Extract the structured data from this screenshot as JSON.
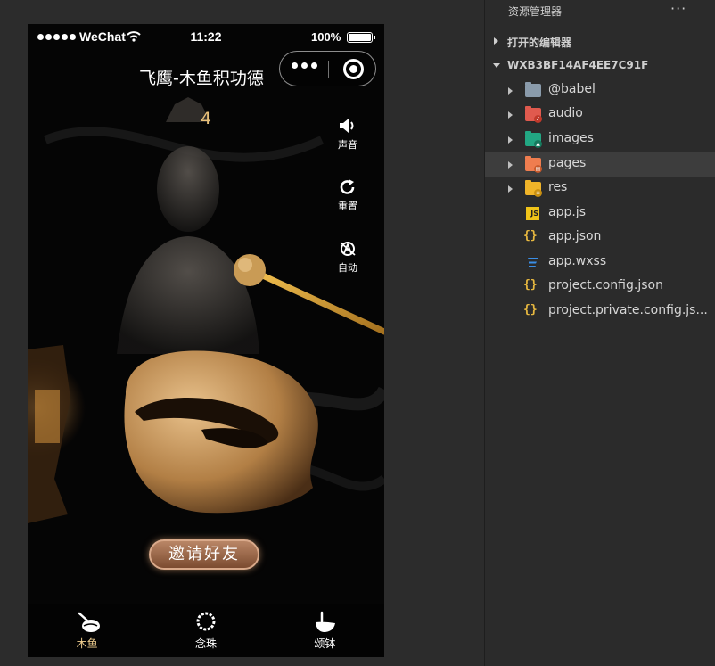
{
  "status_bar": {
    "carrier": "WeChat",
    "time": "11:22",
    "battery": "100%"
  },
  "nav": {
    "title": "飞鹰-木鱼积功德"
  },
  "counter": "4",
  "side_controls": [
    {
      "label": "声音",
      "icon": "speaker-icon"
    },
    {
      "label": "重置",
      "icon": "refresh-icon"
    },
    {
      "label": "自动",
      "icon": "auto-icon"
    }
  ],
  "invite_button": "邀请好友",
  "tabbar": [
    {
      "label": "木鱼",
      "icon": "wooden-fish-icon",
      "active": true
    },
    {
      "label": "念珠",
      "icon": "beads-icon",
      "active": false
    },
    {
      "label": "颂钵",
      "icon": "singing-bowl-icon",
      "active": false
    }
  ],
  "explorer": {
    "title": "资源管理器",
    "more": "···",
    "open_editors": "打开的编辑器",
    "project": "WXB3BF14AF4EE7C91F",
    "items": [
      {
        "name": "@babel",
        "type": "folder",
        "color": "#8a9bab"
      },
      {
        "name": "audio",
        "type": "folder",
        "color": "#e05a4e"
      },
      {
        "name": "images",
        "type": "folder",
        "color": "#22a783"
      },
      {
        "name": "pages",
        "type": "folder",
        "color": "#ef7d4f"
      },
      {
        "name": "res",
        "type": "folder",
        "color": "#f0b429"
      },
      {
        "name": "app.js",
        "type": "js"
      },
      {
        "name": "app.json",
        "type": "json"
      },
      {
        "name": "app.wxss",
        "type": "css"
      },
      {
        "name": "project.config.json",
        "type": "json"
      },
      {
        "name": "project.private.config.js...",
        "type": "json"
      }
    ]
  },
  "colors": {
    "accent_gold": "#e8c07a",
    "tab_active": "#f2d090",
    "explorer_bg": "#2b2b2b"
  }
}
